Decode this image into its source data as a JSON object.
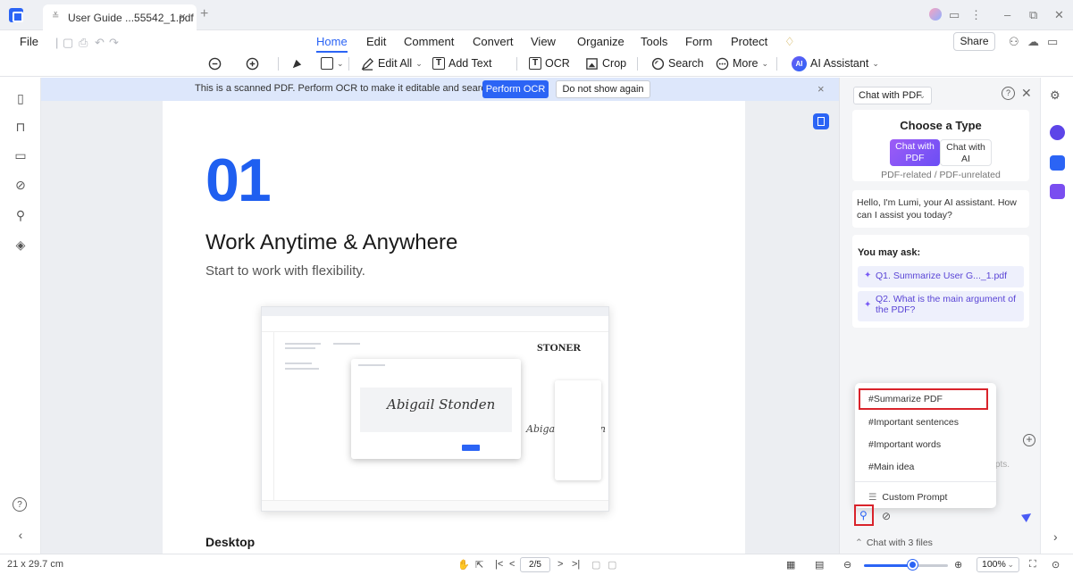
{
  "window": {
    "tab_title": "User Guide ...55542_1.pdf",
    "tab_close": "×",
    "new_tab": "+",
    "controls": [
      "⋮",
      "–",
      "⧉",
      "✕"
    ]
  },
  "menu": {
    "file": "File",
    "items": [
      "Home",
      "Edit",
      "Comment",
      "Convert",
      "View",
      "Organize",
      "Tools",
      "Form",
      "Protect"
    ],
    "active": "Home",
    "share": "Share"
  },
  "toolbar": {
    "edit_all": "Edit All",
    "add_text": "Add Text",
    "ocr": "OCR",
    "crop": "Crop",
    "search": "Search",
    "more": "More",
    "ai_assistant": "AI Assistant",
    "ai_badge": "AI"
  },
  "ocr_banner": {
    "message": "This is a scanned PDF. Perform OCR to make it editable and searchable.",
    "perform": "Perform OCR",
    "dismiss": "Do not show again",
    "close": "×"
  },
  "page": {
    "number": "01",
    "title": "Work Anytime & Anywhere",
    "subtitle": "Start to work with flexibility.",
    "section": "Desktop",
    "mini_brand": "STONER",
    "signature": "Abigail Stonden",
    "signature_small": "Abigail Stonden"
  },
  "ai_panel": {
    "mode_select": "Chat with PDF",
    "choose_type": "Choose a Type",
    "type_pdf": "Chat with PDF",
    "type_ai": "Chat with AI",
    "type_hint": "PDF-related / PDF-unrelated",
    "greeting": "Hello, I'm Lumi, your AI assistant. How can I assist you today?",
    "you_may_ask": "You may ask:",
    "q1": "Q1. Summarize User G..._1.pdf",
    "q2": "Q2. What is the main argument of the PDF?",
    "prompts_hint": "ompts.",
    "popup_items": [
      "#Summarize PDF",
      "#Important sentences",
      "#Important words",
      "#Main idea"
    ],
    "custom_prompt": "Custom Prompt",
    "chat_files": "Chat with 3 files"
  },
  "status": {
    "page_size": "21 x 29.7 cm",
    "page_indicator": "2/5",
    "zoom": "100%"
  },
  "colors": {
    "accent": "#2b64f5",
    "highlight": "#d9232b",
    "purple": "#7a5cf5"
  }
}
